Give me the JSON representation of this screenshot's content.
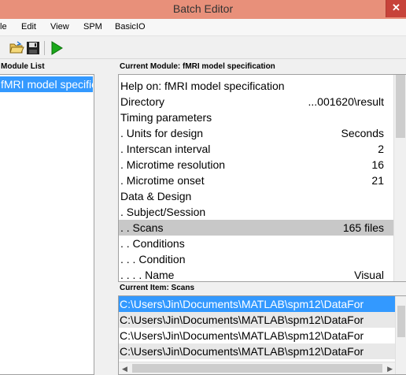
{
  "window": {
    "title": "Batch Editor",
    "close_glyph": "✕"
  },
  "menu": [
    "le",
    "Edit",
    "View",
    "SPM",
    "BasicIO"
  ],
  "toolbar": {
    "buttons": [
      {
        "icon": "open-folder-icon"
      },
      {
        "icon": "save-disk-icon"
      },
      {
        "icon": "run-play-icon",
        "color": "#1aa81a"
      }
    ]
  },
  "module_list": {
    "header": "Module List",
    "items": [
      "fMRI model specification"
    ]
  },
  "current_module": {
    "header": "Current Module: fMRI model specification",
    "rows": [
      {
        "label": "Help on: fMRI model specification",
        "value": ""
      },
      {
        "label": "Directory",
        "value": "...001620\\result"
      },
      {
        "label": "Timing parameters",
        "value": ""
      },
      {
        "label": ". Units for design",
        "value": "Seconds"
      },
      {
        "label": ". Interscan interval",
        "value": "2"
      },
      {
        "label": ". Microtime resolution",
        "value": "16"
      },
      {
        "label": ". Microtime onset",
        "value": "21"
      },
      {
        "label": "Data & Design",
        "value": ""
      },
      {
        "label": ". Subject/Session",
        "value": ""
      },
      {
        "label": ". . Scans",
        "value": "165 files",
        "selected": true
      },
      {
        "label": ". . Conditions",
        "value": ""
      },
      {
        "label": ". . . Condition",
        "value": ""
      },
      {
        "label": ". . . . Name",
        "value": "Visual"
      }
    ]
  },
  "current_item": {
    "header": "Current Item: Scans",
    "items": [
      "C:\\Users\\Jin\\Documents\\MATLAB\\spm12\\DataFor",
      "C:\\Users\\Jin\\Documents\\MATLAB\\spm12\\DataFor",
      "C:\\Users\\Jin\\Documents\\MATLAB\\spm12\\DataFor",
      "C:\\Users\\Jin\\Documents\\MATLAB\\spm12\\DataFor"
    ]
  },
  "colors": {
    "titlebar": "#e8907a",
    "selection": "#3399ff",
    "row_highlight": "#c8c8c8"
  }
}
